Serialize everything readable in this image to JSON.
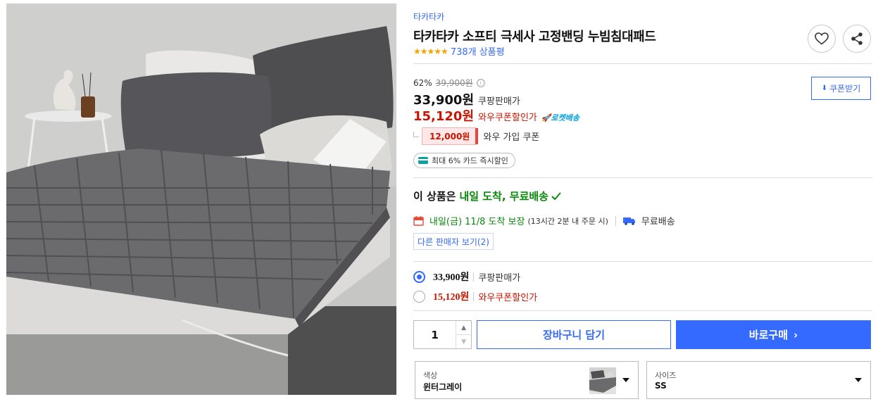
{
  "product": {
    "brand": "타카타카",
    "title": "타카타카 소프티 극세사 고정밴딩 누빔침대패드",
    "stars": "★★★★★",
    "review_count": "738개 상품평",
    "image_alt": "gray quilted fleece bed pad on a bed with pillows"
  },
  "pricing": {
    "discount_rate": "62%",
    "original_price": "39,900원",
    "info_icon": "ⓘ",
    "sale_price": "33,900원",
    "sale_label": "쿠팡판매가",
    "wow_price": "15,120원",
    "wow_label": "와우쿠폰할인가",
    "rocket_label": "로켓배송",
    "coupon_amount": "12,000원",
    "coupon_text": "와우 가입 쿠폰",
    "card_discount": "최대 6% 카드 즉시할인",
    "coupon_button": "쿠폰받기"
  },
  "delivery": {
    "headline_prefix": "이 상품은",
    "headline_green": "내일 도착, 무료배송",
    "arrival": "내일(금) 11/8 도착 보장",
    "arrival_note": "(13시간 2분 내 주문 시)",
    "shipping": "무료배송",
    "other_sellers": "다른 판매자 보기(2)"
  },
  "price_options": [
    {
      "price": "33,900원",
      "label": "쿠팡판매가",
      "selected": true
    },
    {
      "price": "15,120원",
      "label": "와우쿠폰할인가",
      "selected": false
    }
  ],
  "purchase": {
    "quantity": "1",
    "qty_up": "▲",
    "qty_down": "▼",
    "cart_button": "장바구니 담기",
    "buy_button": "바로구매",
    "buy_chevron": "›"
  },
  "options": {
    "color_label": "색상",
    "color_value": "윈터그레이",
    "size_label": "사이즈",
    "size_value": "SS"
  },
  "colors": {
    "accent": "#346aff",
    "price_red": "#cb1400",
    "delivery_green": "#0a8a0a",
    "star": "#f5a300"
  },
  "icons": [
    "heart-icon",
    "share-icon",
    "info-icon",
    "download-icon",
    "rocket-icon",
    "calendar-icon",
    "truck-icon",
    "check-icon",
    "card-icon",
    "caret-down-icon"
  ]
}
